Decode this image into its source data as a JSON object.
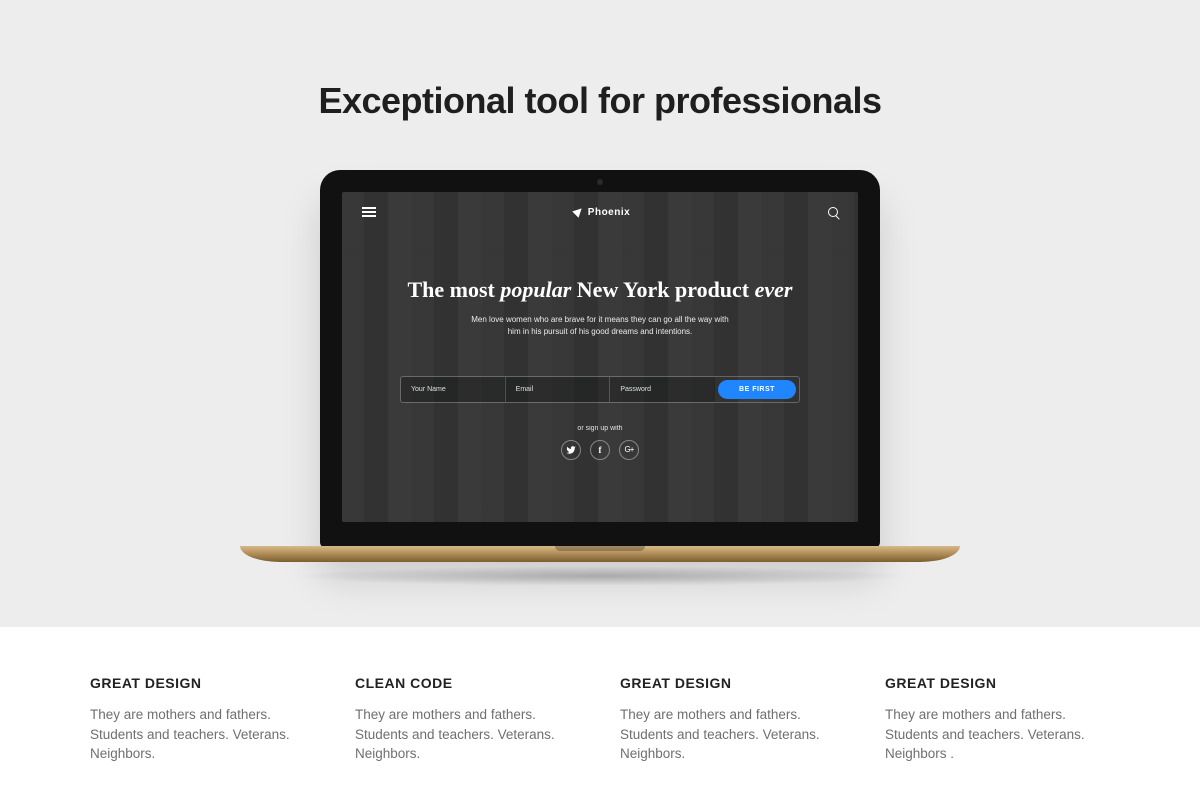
{
  "headline": "Exceptional tool for professionals",
  "laptop_screen": {
    "brand": "Phoenix",
    "title_html": "The most <em>popular</em> New York product <em>ever</em>",
    "subtitle": "Men love women who are brave for it means they can go all the way with him in his pursuit of his good dreams and intentions.",
    "form": {
      "name_placeholder": "Your Name",
      "email_placeholder": "Email",
      "password_placeholder": "Password",
      "cta_label": "BE FIRST"
    },
    "signup_with_label": "or sign up with",
    "social": [
      "twitter",
      "facebook",
      "google-plus"
    ]
  },
  "features": [
    {
      "title": "GREAT DESIGN",
      "body": "They are mothers and fathers. Students and teachers. Veter­ans. Neighbors."
    },
    {
      "title": "CLEAN CODE",
      "body": "They are mothers and fathers. Students and teachers. Veter­ans. Neighbors."
    },
    {
      "title": "GREAT DESIGN",
      "body": "They are mothers and fathers. Students and teachers. Veter­ans. Neighbors."
    },
    {
      "title": "GREAT DESIGN",
      "body": "They are mothers and fathers. Students and teachers. Veter­ans. Neighbors\n."
    }
  ]
}
